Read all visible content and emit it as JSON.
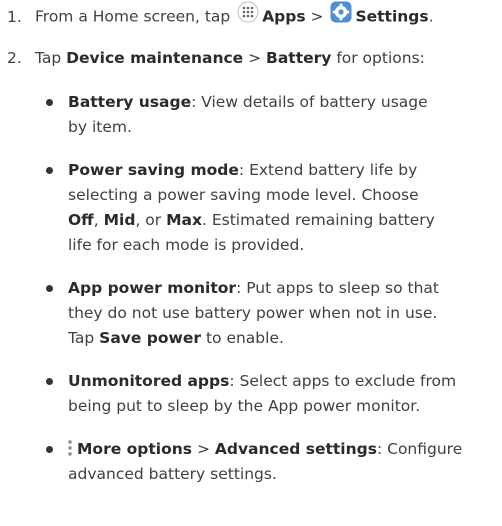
{
  "step1": {
    "number": "1.",
    "text_before": "From a Home screen, tap ",
    "apps_icon": "apps-grid-icon",
    "apps_label": "Apps",
    "separator": " > ",
    "settings_icon": "settings-gear-icon",
    "settings_label": "Settings",
    "end": "."
  },
  "step2": {
    "number": "2.",
    "text_before": "Tap ",
    "device_maintenance": "Device maintenance",
    "separator": " > ",
    "battery": "Battery",
    "text_after": " for options:"
  },
  "bullets": [
    {
      "title": "Battery usage",
      "lines": [
        ": View details of battery usage",
        "by item."
      ]
    },
    {
      "title": "Power saving mode",
      "rest": ": Extend battery life by",
      "line2": "selecting a power saving mode level. Choose",
      "off": "Off",
      "comma1": ", ",
      "mid": "Mid",
      "or": ", or ",
      "max": "Max",
      "line3_tail": ". Estimated remaining battery",
      "line4": "life for each mode is provided."
    },
    {
      "title": "App power monitor",
      "rest": ": Put apps to sleep so that",
      "line2": "they do not use battery power when not in use.",
      "tap": "Tap ",
      "save_power": "Save power",
      "tail": " to enable."
    },
    {
      "title": "Unmonitored apps",
      "rest": ": Select apps to exclude from",
      "line2": "being put to sleep by the App power monitor."
    },
    {
      "icon": "more-options-icon",
      "title": "More options",
      "sep": " > ",
      "advanced": "Advanced settings",
      "rest": ": Configure",
      "line2": "advanced battery settings."
    }
  ]
}
